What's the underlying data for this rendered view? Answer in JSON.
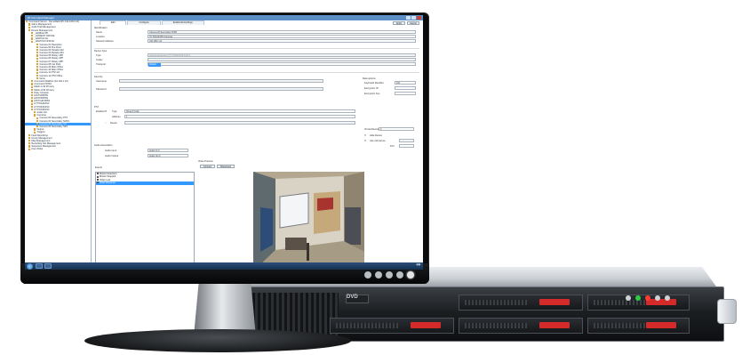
{
  "window": {
    "title": "IP Command Manager"
  },
  "tree": {
    "items": [
      "Command Server - DemoRack(PC 192.168.0.10)",
      "Alarm Management",
      "Audit Trail Management",
      "Device Management",
      "_H/GB/A4 PP",
      "_HVIDENT OFFICE",
      "_H/GP/C2 4H",
      "_H/GP/CD OFFICE",
      "Camera 01 Reception",
      "Camera 02 Fire Door",
      "Camera 03 Parade 1&2",
      "Camera 04 Parade 3&4",
      "Camera 05 Rotary 4PP",
      "Camera 06 Rotary 4PP",
      "Camera 07 Rotary 4PP",
      "Camera 08 Car Park",
      "Camera 09 Main Office",
      "Camera 10 Main Office",
      "Camera 11 PTZ 1/4",
      "Camera 12 PTZ Office",
      "Items",
      "Command Rail/box (10.192.1.10)",
      "Command NVR1",
      "Matrix 1/10 Primary",
      "Matrix 2/10 Primary",
      "Diary Intrusion",
      "HIKT1DS5TE",
      "HIKT2DS5TE",
      "HIKT1HK4RSS",
      "HYTFIA4K4S2",
      "HYTFIK4K4S3",
      "HYTFIK4K4S4",
      "Audio Out",
      "Cameras",
      "Camera 00 Secondary PTZ",
      "Camera 00 Secondary NVR1",
      "Camera 00 Secondary 4.0",
      "Camera 00 Secondary NP1",
      "Output",
      "Triggers",
      "Fault Recording",
      "Group Management",
      "Map Management",
      "Recording Job Management",
      "Sequence Management",
      "User Roles"
    ],
    "selected_index": 36
  },
  "tabs": [
    "Edit",
    "Configure",
    "Enable Recordings"
  ],
  "header_buttons": {
    "apply": "Apply",
    "cancel": "Cancel"
  },
  "identification": {
    "section": "Identification",
    "name_label": "Name",
    "name_value": "Camera 02 Secondary NVR3",
    "location_label": "Location",
    "location_value": "HYTFIK4K4S5 Cameras",
    "address_label": "Network Address",
    "address_value": "192.168.1.44"
  },
  "device_type": {
    "section": "Device Type",
    "type_label": "Type",
    "type_value": "Camera-dependent | HYTFIK4K4S5 Input 4",
    "codec_label": "Codec",
    "transport_label": "Transport",
    "transport_value": "Default"
  },
  "security": {
    "section": "Security",
    "username_label": "Username",
    "password_label": "Password"
  },
  "ptz": {
    "section": "PTZ",
    "enabled_label": "Enabled",
    "type_label": "Type",
    "type_value": "Nmea P Axial",
    "address_label": "Address",
    "address_value": "1",
    "router_label": "Router"
  },
  "audio": {
    "section": "Audio Association",
    "input_label": "Audio Input",
    "input_value": "Audio Int 0",
    "output_label": "Audio Output",
    "output_value": "Audio Out 0"
  },
  "right_panel": {
    "data_options": "Data options",
    "keyboard_label": "Keyboard Identifier",
    "keyboard_value": "102",
    "encryption_id_label": "Encryption ID",
    "encryption_key_label": "Encryption Key",
    "virtual_label": "Virtual Decoder",
    "virtual_value": "0",
    "hide_label": "Hide Device",
    "use_ref_label": "Use ref/macros",
    "port_label": "Port"
  },
  "events": {
    "section": "Events",
    "items": [
      "Motion Detection",
      "Motion Stopped",
      "Video Lost",
      "Video Restored"
    ],
    "selected_index": 3
  },
  "video_preview": {
    "section": "Video Preview",
    "connect": "Connect",
    "disconnect": "Disconnect"
  },
  "server": {
    "dvd_label": "DVD"
  }
}
